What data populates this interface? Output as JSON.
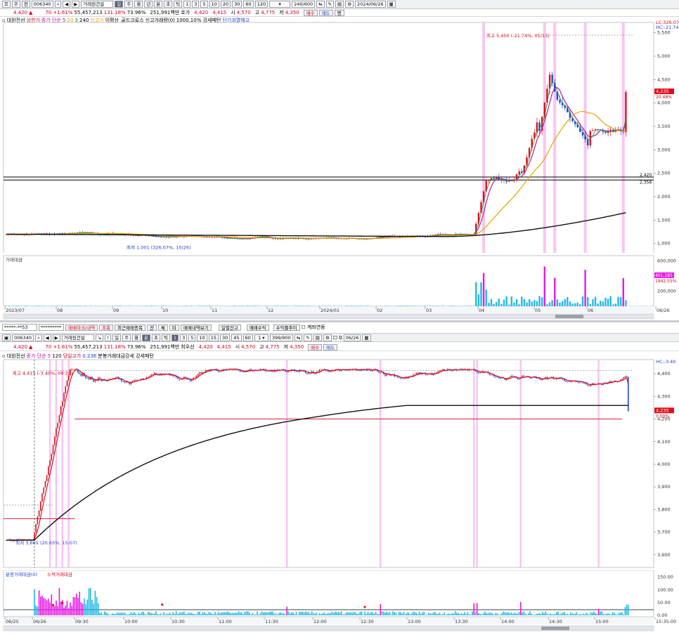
{
  "top_toolbar": {
    "code": "006340",
    "mode": "거래원건설",
    "periods": [
      "주",
      "월",
      "년",
      "분",
      "초",
      "틱"
    ],
    "intervals": [
      "1",
      "3",
      "5",
      "10",
      "20",
      "30",
      "60",
      "120"
    ],
    "count": "240/600",
    "date": "2024/06/26"
  },
  "quote": {
    "price": "4,420",
    "change": "70",
    "pct": "+1.61%",
    "volume": "55,457,213",
    "vol_ratio": "131.18%",
    "turnover_ratio": "73.96%",
    "amount": "251,991백만",
    "ask_label": "호가",
    "ask": "4,420",
    "bid": "4,415",
    "open_label": "시",
    "open": "4,570",
    "high_label": "고",
    "high": "4,775",
    "low_label": "저",
    "low": "4,350",
    "buy_label": "매수",
    "sell_label": "매도",
    "eq_label": "평"
  },
  "top_legend": {
    "items": [
      "대원전선",
      "상한가",
      "종가 단순 5",
      "20",
      "3",
      "240",
      "신고가",
      "이평선_골드크로스",
      "신고거래량(0)",
      "1000,10% 강세패턴",
      "단기과열해고"
    ]
  },
  "top_chart": {
    "lc": "LC:326.07",
    "hc": "HC:-21.74",
    "y_ticks": [
      "5,500",
      "5,000",
      "4,500",
      "4,000",
      "3,500",
      "3,000",
      "2,500",
      "2,000",
      "1,500",
      "1,000"
    ],
    "hi_note": "최고 5,450 (-21.74%, 05/13)",
    "lo_note": "최저 1,001 (326.07%, 10/26)",
    "hline_labels": [
      "2,420",
      "2,356"
    ],
    "price_tag": "4,235",
    "price_pct": "20.48%"
  },
  "top_volume": {
    "label": "거래대금",
    "y_ticks": [
      "600,000",
      "200,000"
    ],
    "tag1": "401,185",
    "tag2": "1942.55%",
    "x_ticks": [
      "2023/07",
      "08",
      "09",
      "10",
      "11",
      "12",
      "2024/01",
      "02",
      "03",
      "04",
      "05",
      "06",
      "06/26"
    ]
  },
  "bottom_tabs": {
    "acct": "*****-**53",
    "pwd": "*********",
    "tabs": [
      "매매마크/내역",
      "조회",
      "최근매매종목",
      "잔",
      "체",
      "미",
      "매매내역보기",
      "일별잔고",
      "매매수익",
      "수익률추이",
      "계좌연동"
    ]
  },
  "bottom_toolbar": {
    "code": "006340",
    "mode": "거래원건설",
    "periods": [
      "일",
      "주",
      "월",
      "분",
      "초",
      "틱"
    ],
    "intervals": [
      "1",
      "3",
      "5",
      "10",
      "15",
      "30",
      "45",
      "60"
    ],
    "count": "399/900",
    "date": "06/26"
  },
  "bottom_quote": {
    "price": "4,420",
    "change": "70",
    "pct": "+1.61%",
    "volume": "55,457,213",
    "vol_ratio": "131.18%",
    "turnover_ratio": "73.96%",
    "amount": "251,991백만",
    "ask_label": "최우선",
    "ask": "4,420",
    "bid": "4,415",
    "open_label": "시",
    "open": "4,570",
    "high_label": "고",
    "high": "4,775",
    "low_label": "저",
    "low": "4,350",
    "buy_label": "매수",
    "sell_label": "매도"
  },
  "bottom_legend": {
    "items": [
      "대원전선",
      "종가 단순 5",
      "120",
      "당일고가",
      "0.236",
      "분봉거래대금강세 강세패턴"
    ]
  },
  "bottom_chart": {
    "lc": "LC:20.65",
    "hc": "HC:-3.40",
    "y_ticks": [
      "4,400",
      "4,300",
      "4,200",
      "4,100",
      "4,000",
      "3,900",
      "3,800",
      "3,700",
      "3,600"
    ],
    "hi_note": "최고 4,415 (-3.40%, 09:29)",
    "lo_note": "최저 3,665 (20.65%, 15:07)",
    "price_tag": "4,235",
    "price_pct": "0.00%"
  },
  "bottom_volume": {
    "label": "분봉거래대금(0)",
    "label2": "누적거래대금",
    "y_ticks": [
      "150.00",
      "100.00",
      "50.00",
      "0.00"
    ],
    "x_ticks": [
      "06/25",
      "06/26",
      "09:30",
      "10:00",
      "10:30",
      "11:00",
      "11:30",
      "12:00",
      "12:30",
      "13:00",
      "13:30",
      "14:00",
      "14:30",
      "15:00",
      "15:35:00"
    ]
  },
  "chart_data": [
    {
      "type": "candlestick",
      "title": "대원전선 daily",
      "x": [
        "2023/07",
        "08",
        "09",
        "10",
        "11",
        "12",
        "2024/01",
        "02",
        "03",
        "04",
        "05",
        "06"
      ],
      "series": [
        {
          "name": "close",
          "values": [
            1200,
            1150,
            1080,
            1050,
            1080,
            1100,
            1120,
            1150,
            1200,
            2300,
            4700,
            3600
          ]
        }
      ],
      "ylim": [
        800,
        5600
      ],
      "annotations": [
        "최고 5,450 (-21.74%, 05/13)",
        "최저 1,001 (326.07%, 10/26)"
      ]
    },
    {
      "type": "line",
      "title": "대원전선 minute",
      "x": [
        "09:00",
        "09:30",
        "10:00",
        "10:30",
        "11:00",
        "11:30",
        "12:00",
        "12:30",
        "13:00",
        "13:30",
        "14:00",
        "14:30",
        "15:00",
        "15:30"
      ],
      "series": [
        {
          "name": "close",
          "values": [
            3665,
            4380,
            4240,
            4190,
            4300,
            4270,
            4320,
            4280,
            4260,
            4370,
            4230,
            4270,
            4220,
            4235
          ]
        }
      ],
      "ylim": [
        3550,
        4450
      ]
    }
  ]
}
